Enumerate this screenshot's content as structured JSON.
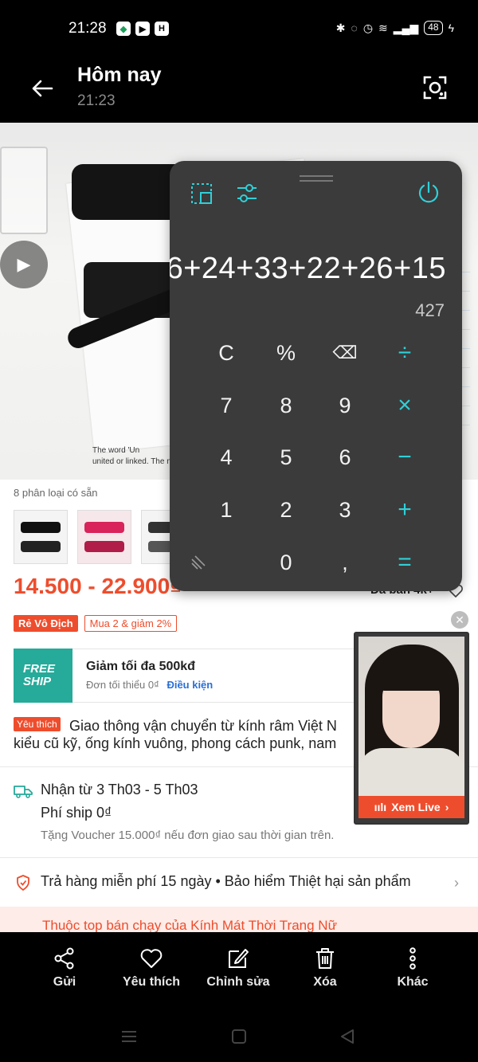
{
  "status": {
    "time": "21:28",
    "battery": "48"
  },
  "header": {
    "title": "Hôm nay",
    "subtitle": "21:23"
  },
  "photo": {
    "caption_line1": "The word 'Un",
    "caption_line2": "united or linked. The n"
  },
  "product": {
    "variants_label": "8 phân loại có sẵn",
    "price": "14.500 - 22.900₫",
    "sold": "Đã bán 4k+",
    "badge_primary": "Rẻ Vô Địch",
    "badge_secondary": "Mua 2 & giảm 2%",
    "freeship_line1": "FREE",
    "freeship_line2": "SHIP",
    "voucher_title": "Giảm tối đa 500kđ",
    "voucher_sub": "Đơn tối thiểu 0₫",
    "voucher_link": "Điều kiện",
    "favorite_tag": "Yêu thích",
    "description_line1": "Giao thông vận chuyển từ kính râm Việt N",
    "description_line2": "kiểu cũ kỹ, ống kính vuông, phong cách punk, nam",
    "ship_dates": "Nhận từ 3 Th03 - 5 Th03",
    "ship_fee": "Phí ship 0₫",
    "ship_voucher": "Tặng Voucher 15.000₫ nếu đơn giao sau thời gian trên.",
    "guarantee": "Trả hàng miễn phí 15 ngày  •  Bảo hiểm Thiệt hại sản phẩm",
    "bestseller": "Thuộc top bán chạy của Kính Mát Thời Trang Nữ"
  },
  "live": {
    "button_label": "Xem Live"
  },
  "calculator": {
    "expression": "6+24+33+22+26+15",
    "result": "427",
    "keys": [
      "C",
      "%",
      "⌫",
      "÷",
      "7",
      "8",
      "9",
      "×",
      "4",
      "5",
      "6",
      "−",
      "1",
      "2",
      "3",
      "+",
      "0",
      ",",
      "="
    ]
  },
  "actions": {
    "share": "Gửi",
    "favorite": "Yêu thích",
    "edit": "Chỉnh sửa",
    "delete": "Xóa",
    "more": "Khác"
  },
  "colors": {
    "accent": "#ee4d2d",
    "calc_bg": "#3b3b3b",
    "calc_op": "#2fd0d8",
    "freeship": "#26aa99"
  }
}
